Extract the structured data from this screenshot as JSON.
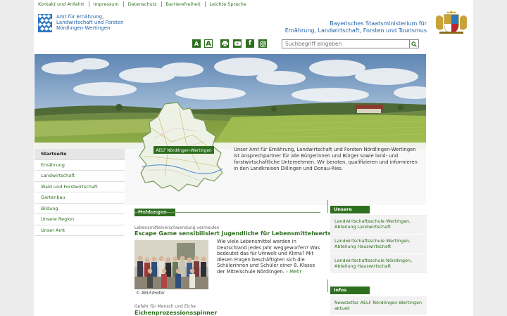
{
  "topnav": [
    "Kontakt und Anfahrt",
    "Impressum",
    "Datenschutz",
    "Barrierefreiheit",
    "Leichte Sprache"
  ],
  "header": {
    "amt_lines": [
      "Amt für Ernährung,",
      "Landwirtschaft und Forsten",
      "Nördlingen-Wertingen"
    ],
    "ministry_lines": [
      "Bayerisches Staatsministerium für",
      "Ernährung, Landwirtschaft, Forsten und Tourismus"
    ]
  },
  "toolbar": {
    "font_small": "A",
    "font_large": "A",
    "print_icon": "print-icon",
    "youtube_icon": "youtube-icon",
    "facebook_icon": "f",
    "instagram_icon": "instagram-icon"
  },
  "search": {
    "placeholder": "Suchbegriff eingeben",
    "value": "Suchbegriff eingeben"
  },
  "map_label": "AELF Nördlingen-Wertingen",
  "sidebar": {
    "items": [
      "Startseite",
      "Ernährung",
      "Landwirtschaft",
      "Wald und Forstwirtschaft",
      "Gartenbau",
      "Bildung",
      "Unsere Region",
      "Unser Amt"
    ],
    "active": "Startseite"
  },
  "intro_text": "Unser Amt für Ernährung, Landwirtschaft und Forsten Nördlingen-Wertingen ist Ansprechpartner für alle Bürgerinnen und Bürger sowie land- und forstwirtschaftliche Unternehmen. Wir beraten, qualifizieren und informieren in den Landkreisen Dillingen und Donau-Ries.",
  "news": {
    "heading": "Meldungen",
    "items": [
      {
        "kicker": "Lebensmittelverschwendung vermeiden",
        "title": "Escape Game sensibilisiert Jugendliche für Lebensmittelwertschätzung",
        "text": "Wie viele Lebensmittel werden in Deutschland jedes Jahr weggeworfen? Was bedeutet das für Umwelt und Klima? Mit diesen Fragen beschäftigten sich die Schülerinnen und Schüler einer 8. Klasse der Mittelschule Nördlingen.",
        "more": "› Mehr",
        "caption": "© AELF/Hofer"
      },
      {
        "kicker": "Gefahr für Mensch und Eiche",
        "title": "Eichenprozessionsspinner"
      }
    ]
  },
  "right": {
    "schools_heading": "Unsere Schulen",
    "schools": [
      "Landwirtschaftsschule Wertingen, Abteilung Landwirtschaft",
      "Landwirtschaftsschule Wertingen, Abteilung Hauswirtschaft",
      "Landwirtschaftsschule Nördlingen, Abteilung Hauswirtschaft"
    ],
    "info_heading": "Infos erhalten",
    "info_items": [
      "Newsletter AELF Nördlingen-Wertingen aktuell"
    ]
  },
  "colors": {
    "accent": "#2e6e1f",
    "ministry_blue": "#1f5fa8",
    "bavaria_blue": "#2a77c2"
  }
}
